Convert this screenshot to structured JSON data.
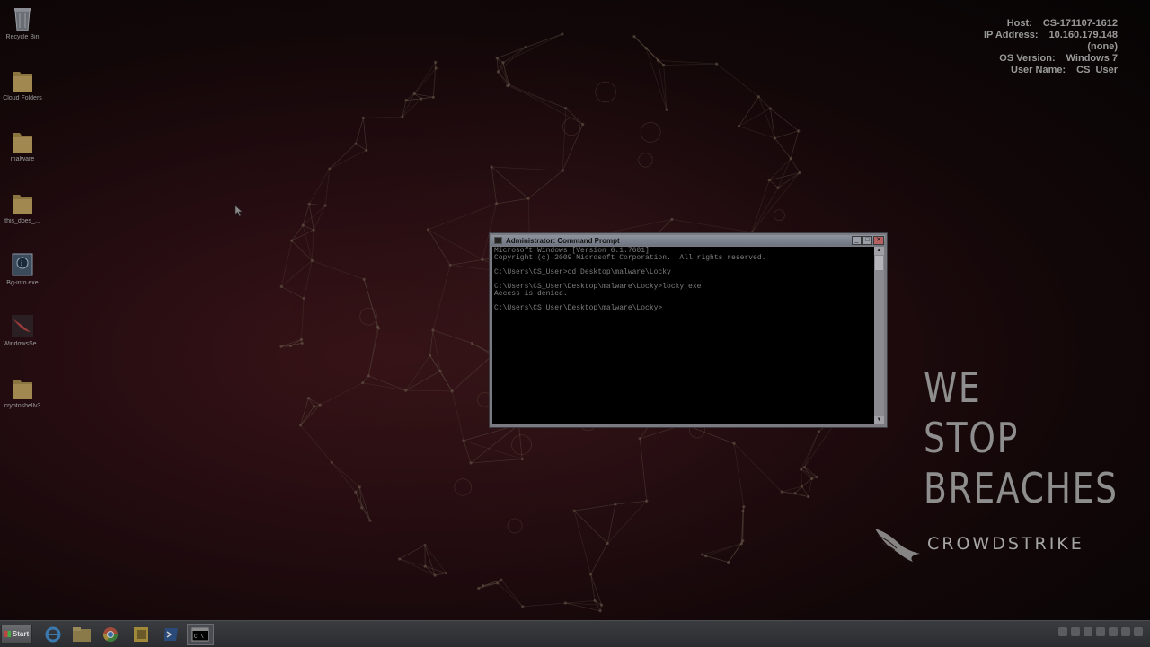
{
  "desktop": {
    "icons": [
      {
        "label": "Recycle Bin",
        "icon": "recycle-bin-icon"
      },
      {
        "label": "Cloud Folders",
        "icon": "folder-icon"
      },
      {
        "label": "malware",
        "icon": "folder-icon"
      },
      {
        "label": "this_does_...",
        "icon": "folder-icon"
      },
      {
        "label": "Bg-info.exe",
        "icon": "bginfo-icon"
      },
      {
        "label": "WindowsSe...",
        "icon": "crowdstrike-icon"
      },
      {
        "label": "cryptoshellv3",
        "icon": "folder-icon"
      }
    ]
  },
  "bginfo": {
    "host_label": "Host:",
    "host_value": "CS-171107-1612",
    "ip_label": "IP Address:",
    "ip_value": "10.160.179.148",
    "ip_value2": "(none)",
    "os_label": "OS Version:",
    "os_value": "Windows 7",
    "user_label": "User Name:",
    "user_value": "CS_User"
  },
  "slogan": {
    "line1": "WE",
    "line2": "STOP",
    "line3": "BREACHES",
    "brand": "CROWDSTRIKE"
  },
  "cmd": {
    "title": "Administrator: Command Prompt",
    "lines": [
      "Microsoft Windows [Version 6.1.7601]",
      "Copyright (c) 2009 Microsoft Corporation.  All rights reserved.",
      "",
      "C:\\Users\\CS_User>cd Desktop\\malware\\Locky",
      "",
      "C:\\Users\\CS_User\\Desktop\\malware\\Locky>locky.exe",
      "Access is denied.",
      "",
      "C:\\Users\\CS_User\\Desktop\\malware\\Locky>_"
    ]
  },
  "taskbar": {
    "start_label": "Start",
    "buttons": [
      "ie-icon",
      "explorer-icon",
      "chrome-icon",
      "notes-icon",
      "powershell-icon",
      "cmd-icon"
    ]
  },
  "colors": {
    "background": "#120708",
    "text_dim": "#9a9a9a",
    "cmd_text": "#7d7d7d",
    "taskbar": "#2e3034"
  }
}
